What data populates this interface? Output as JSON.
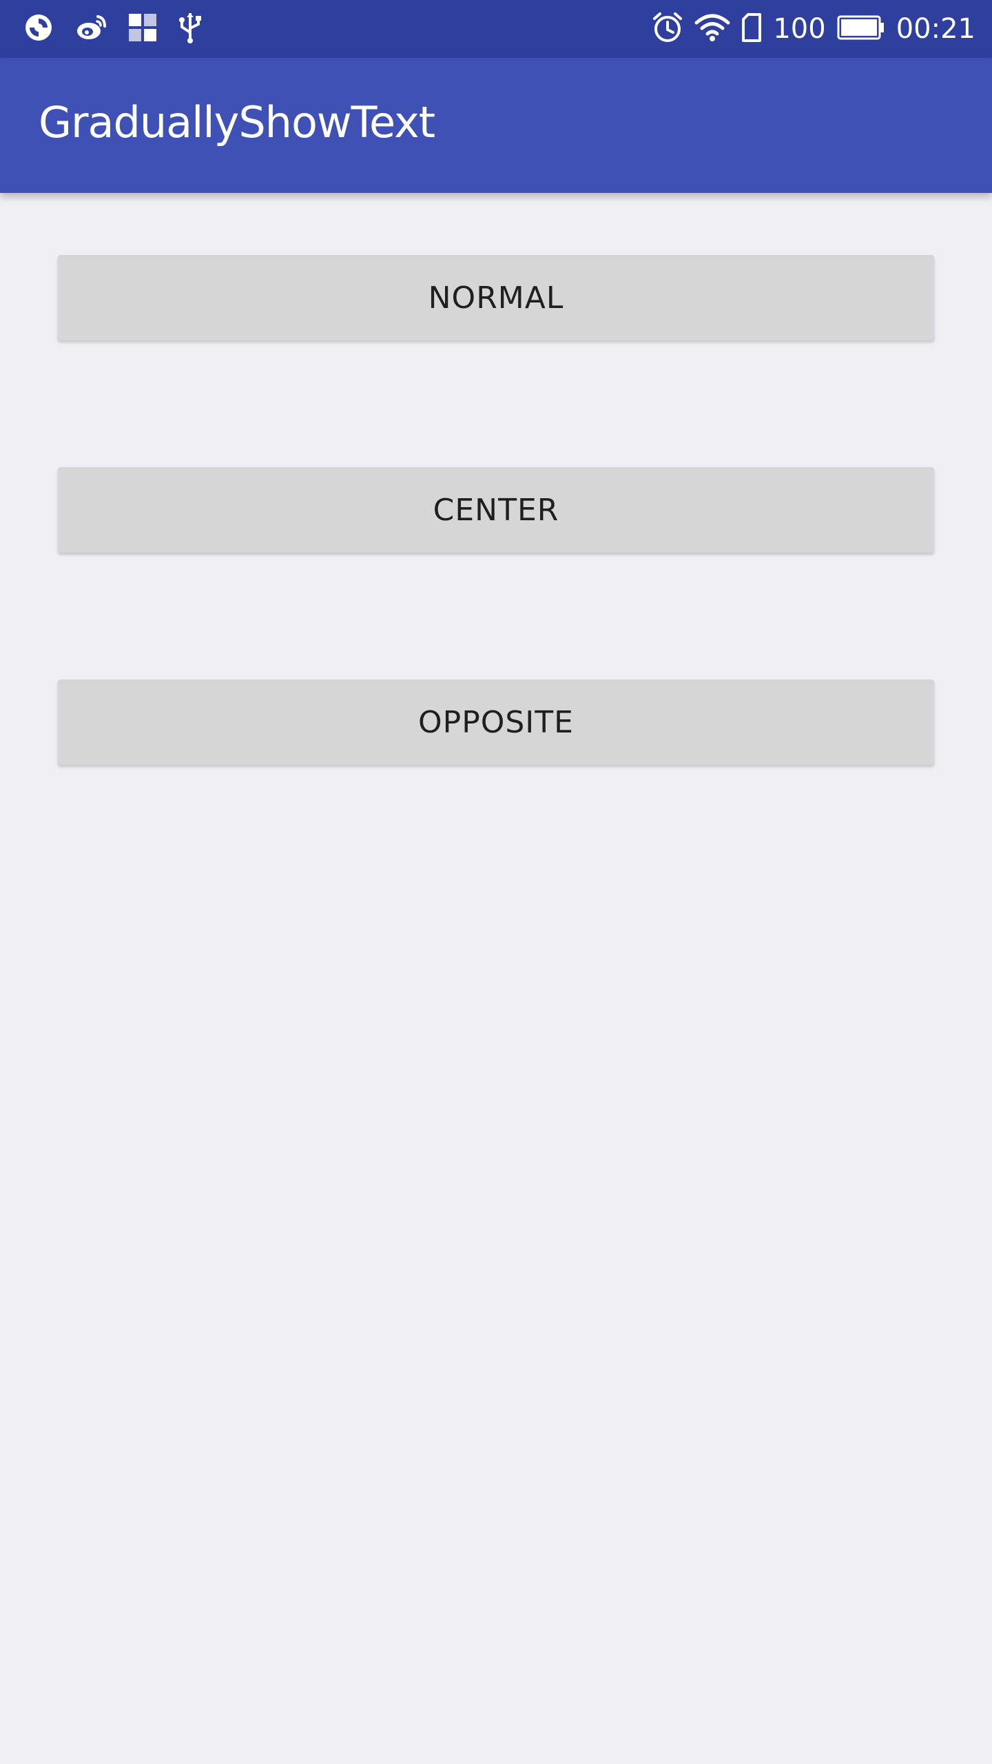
{
  "status_bar": {
    "icons_left": [
      "sync-icon",
      "weibo-icon",
      "app-grid-icon",
      "usb-icon"
    ],
    "icons_right": [
      "alarm-icon",
      "wifi-icon",
      "sim-icon"
    ],
    "battery_level": "100",
    "battery_percent": 100,
    "time": "00:21"
  },
  "app_bar": {
    "title": "GraduallyShowText",
    "color": "#3f51b5"
  },
  "buttons": {
    "normal": "NORMAL",
    "center": "CENTER",
    "opposite": "OPPOSITE"
  },
  "colors": {
    "status_bar": "#2f3f9e",
    "background": "#f0eff4",
    "button": "#d6d6d7"
  }
}
